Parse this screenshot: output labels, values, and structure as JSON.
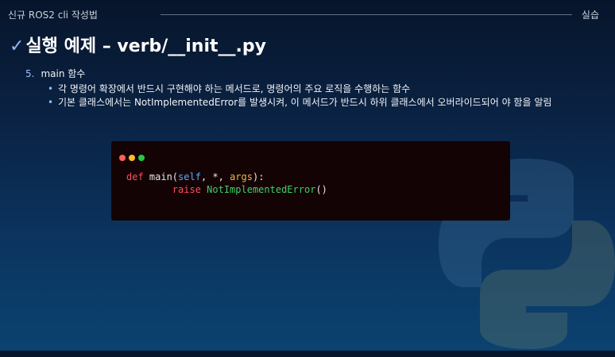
{
  "header": {
    "course_title": "신규 ROS2 cli 작성법",
    "section": "실습"
  },
  "slide": {
    "check_mark": "✓",
    "title": "실행 예제 – verb/__init__.py"
  },
  "content": {
    "number": "5.",
    "heading": "main 함수",
    "bullets": [
      "각 명령어 확장에서 반드시 구현해야 하는 메서드로, 명령어의 주요 로직을 수행하는 함수",
      "기본 클래스에서는 NotImplementedError를 발생시켜, 이 메서드가 반드시 하위 클래스에서 오버라이드되어 야 함을 알림"
    ]
  },
  "code": {
    "line1": {
      "kw": "def",
      "fn": " main(",
      "self": "self",
      "mid": ", *, ",
      "args": "args",
      "end": "):"
    },
    "line2": {
      "indent": "        ",
      "kw": "raise",
      "space": " ",
      "cls": "NotImplementedError",
      "end": "()"
    }
  },
  "colors": {
    "background_top": "#07152b",
    "background_bottom": "#0b4270",
    "code_bg": "#140304",
    "keyword": "#ff4d5f",
    "self": "#5aa9ff",
    "param": "#e8b84a",
    "class": "#3fcf6a"
  },
  "decor": {
    "background_logo": "python-logo-icon"
  }
}
